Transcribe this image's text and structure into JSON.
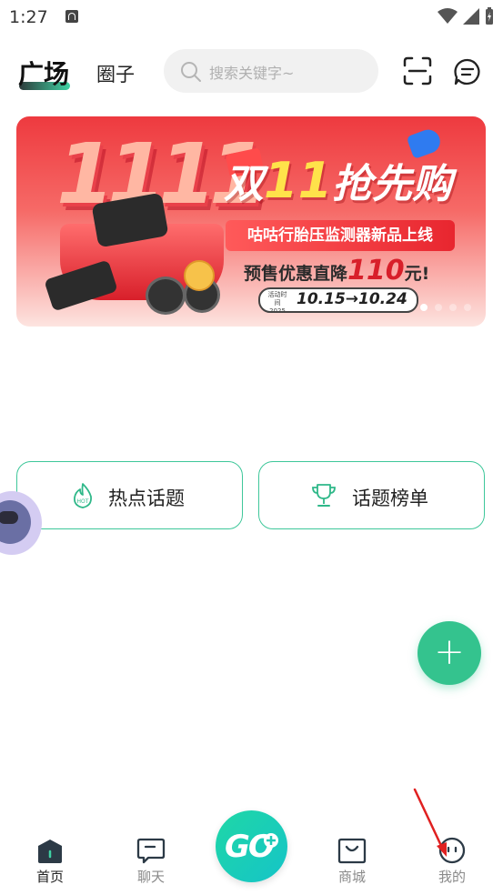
{
  "status_bar": {
    "time": "1:27"
  },
  "top_nav": {
    "tabs": [
      {
        "label": "广场",
        "active": true
      },
      {
        "label": "圈子",
        "active": false
      }
    ],
    "search_placeholder": "搜索关键字~"
  },
  "banner": {
    "big_number": "1111",
    "headline_prefix": "双",
    "headline_number": "11",
    "headline_suffix": "抢先购",
    "subtitle": "咕咕行胎压监测器新品上线",
    "offer_prefix": "预售优惠直降",
    "offer_price": "110",
    "offer_suffix": "元!",
    "date_label": "活动时间 2025",
    "date_range": "10.15→10.24",
    "active_slide": 0,
    "slide_count": 4
  },
  "topics": [
    {
      "label": "热点话题",
      "icon": "hot-icon"
    },
    {
      "label": "话题榜单",
      "icon": "trophy-icon"
    }
  ],
  "fab": {
    "symbol": "+"
  },
  "bottom_nav": {
    "items": [
      {
        "label": "首页",
        "icon": "home-icon",
        "active": true
      },
      {
        "label": "聊天",
        "icon": "chat-icon",
        "active": false
      },
      {
        "label": "商城",
        "icon": "shop-bag-icon",
        "active": false
      },
      {
        "label": "我的",
        "icon": "profile-icon",
        "active": false
      }
    ],
    "center_button_text": "GO"
  },
  "colors": {
    "accent_green": "#34c38e",
    "go_gradient_start": "#1fd7a6",
    "go_gradient_end": "#15c4c8",
    "banner_red": "#ee3a3f",
    "annotation_arrow": "#e02020"
  }
}
